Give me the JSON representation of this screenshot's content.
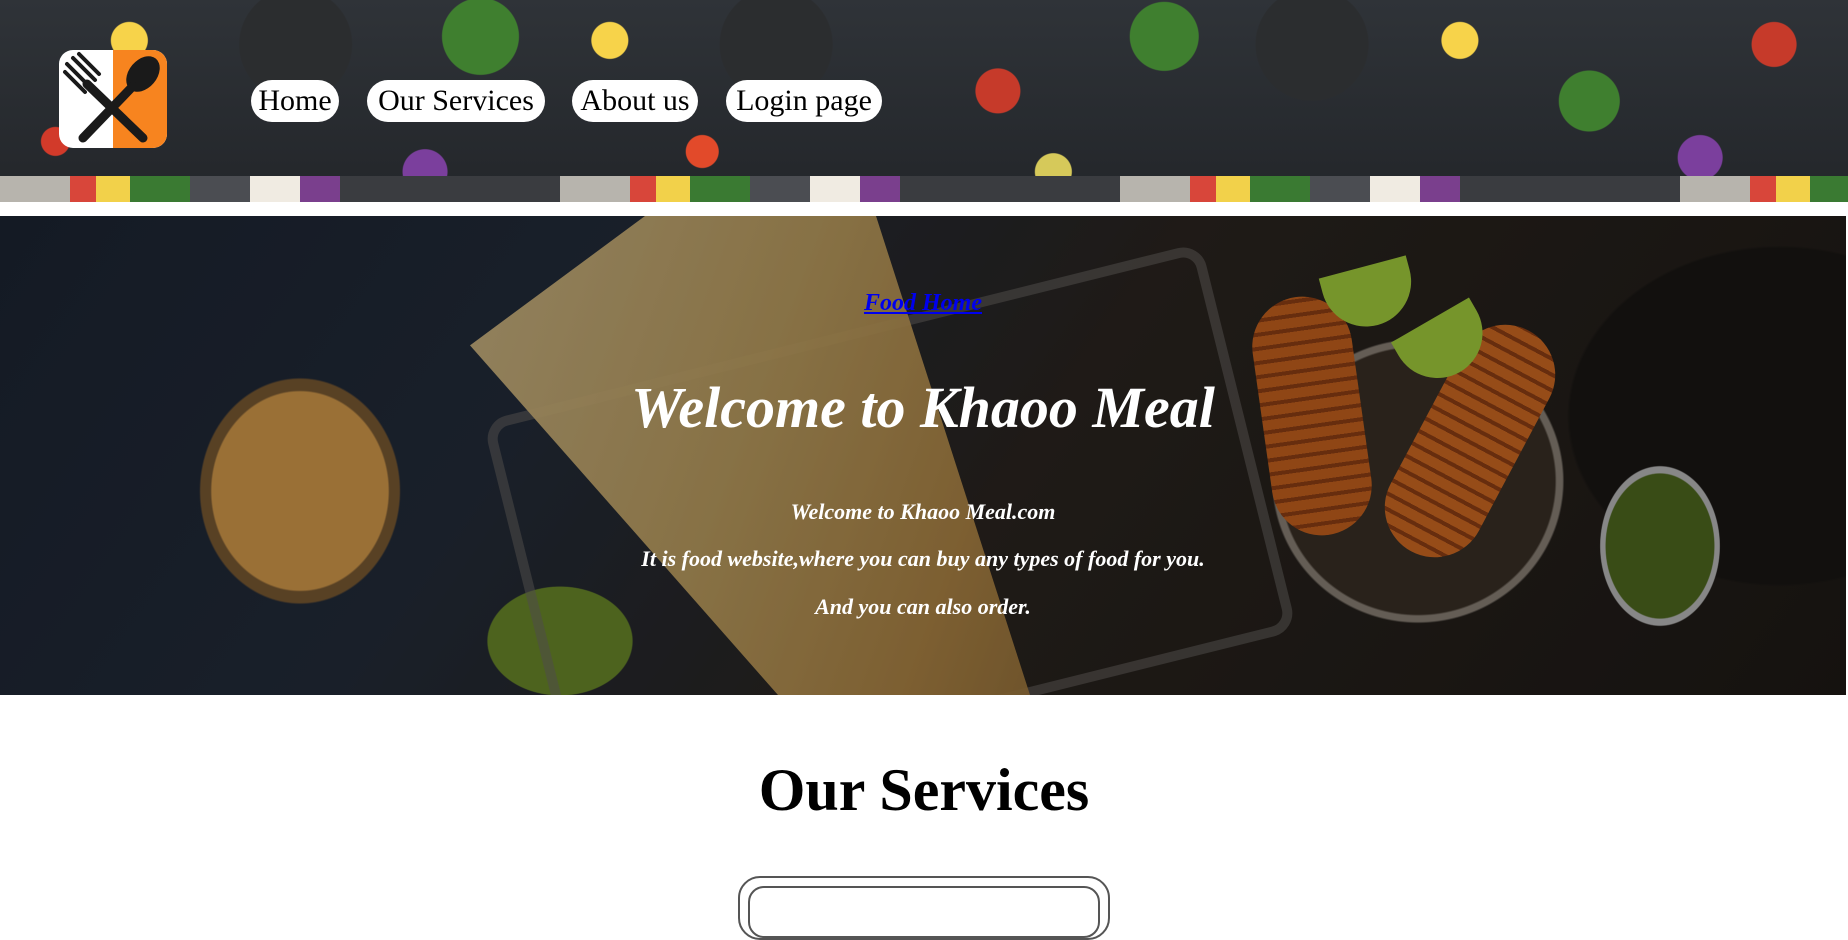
{
  "nav": {
    "items": [
      {
        "label": "Home"
      },
      {
        "label": "Our Services"
      },
      {
        "label": "About us"
      },
      {
        "label": "Login page"
      }
    ]
  },
  "logo": {
    "icon": "fork-spoon-icon"
  },
  "hero": {
    "link_text": "Food Home",
    "title": "Welcome to Khaoo Meal",
    "line1": "Welcome to Khaoo Meal.com",
    "line2": "It is food website,where you can buy any types of food for you.",
    "line3": "And you can also order."
  },
  "services": {
    "heading": "Our Services"
  },
  "colors": {
    "logo_accent": "#f7841f",
    "link": "#0000ee",
    "hero_text": "#ffffff"
  }
}
